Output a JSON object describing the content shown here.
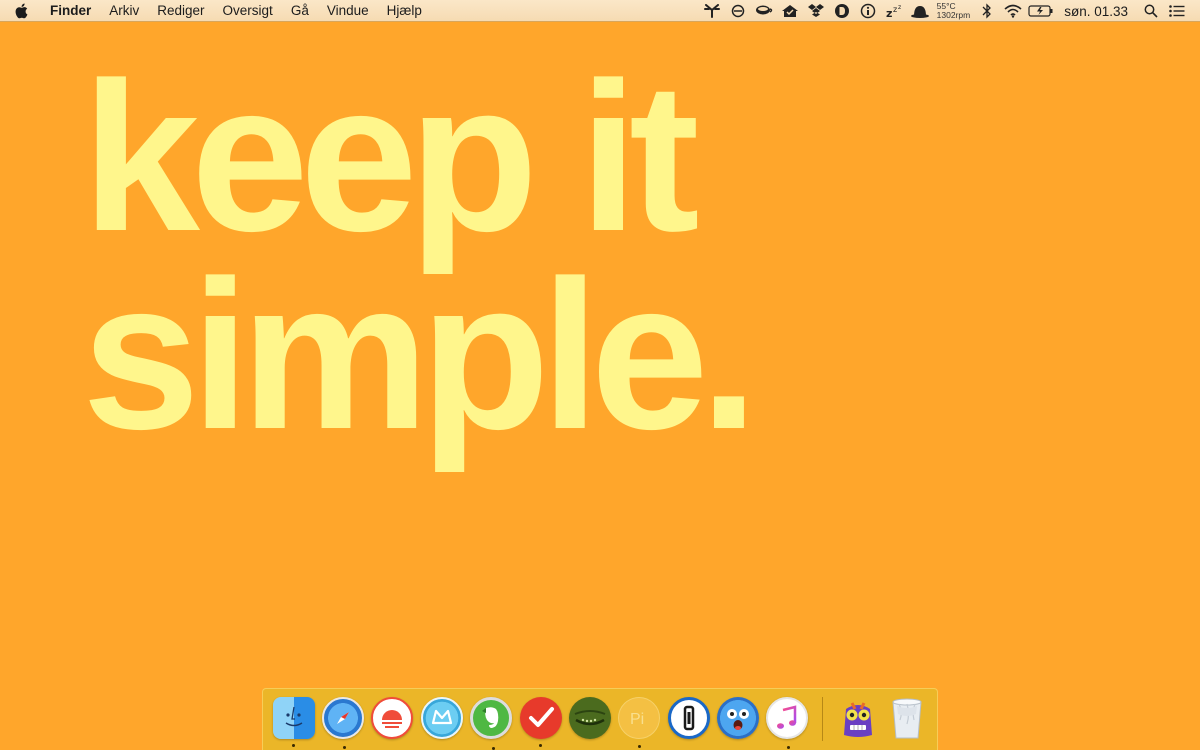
{
  "menubar": {
    "apple_icon": "apple-logo-icon",
    "app_name": "Finder",
    "items": [
      "Arkiv",
      "Rediger",
      "Oversigt",
      "Gå",
      "Vindue",
      "Hjælp"
    ],
    "status": {
      "temperature": "55°C",
      "fan_speed": "1302rpm",
      "clock": "søn. 01.33"
    }
  },
  "wallpaper": {
    "line1": "keep it",
    "line2": "simple.",
    "background_color": "#ffa62b",
    "text_color": "#fff68c"
  },
  "dock": {
    "apps": [
      {
        "name": "Finder",
        "icon": "finder-icon",
        "running": true
      },
      {
        "name": "Safari",
        "icon": "safari-icon",
        "running": true
      },
      {
        "name": "Sunrise",
        "icon": "sunrise-calendar-icon",
        "running": false
      },
      {
        "name": "Mail",
        "icon": "mail-icon",
        "running": false
      },
      {
        "name": "Evernote",
        "icon": "evernote-icon",
        "running": true
      },
      {
        "name": "Todoist",
        "icon": "todoist-icon",
        "running": true
      },
      {
        "name": "Frog app",
        "icon": "frog-icon",
        "running": false
      },
      {
        "name": "Pi",
        "icon": "pi-icon",
        "running": true
      },
      {
        "name": "1Password",
        "icon": "1password-icon",
        "running": false
      },
      {
        "name": "Tweetbot",
        "icon": "tweetbot-icon",
        "running": false
      },
      {
        "name": "iTunes",
        "icon": "itunes-icon",
        "running": true
      },
      {
        "name": "Monster app",
        "icon": "monster-icon",
        "running": false
      },
      {
        "name": "Trash",
        "icon": "trash-icon",
        "running": false
      }
    ]
  }
}
